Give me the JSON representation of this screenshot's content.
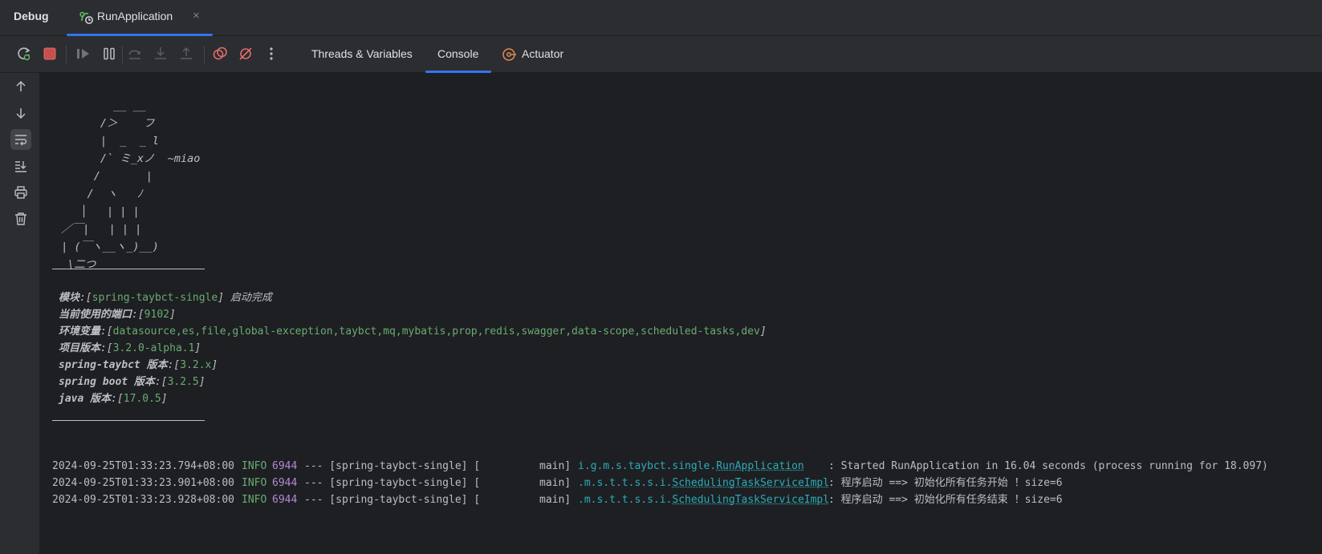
{
  "window": {
    "debug_title": "Debug",
    "run_tab": {
      "label": "RunApplication",
      "close": "×",
      "icon": "run-config-icon"
    }
  },
  "toolbar": {
    "buttons": [
      {
        "name": "rerun-button",
        "icon": "rerun-icon"
      },
      {
        "name": "stop-button",
        "icon": "stop-icon"
      },
      {
        "name": "resume-button",
        "icon": "resume-icon"
      },
      {
        "name": "pause-button",
        "icon": "pause-icon"
      },
      {
        "name": "step-over-button",
        "icon": "step-over-icon"
      },
      {
        "name": "step-into-button",
        "icon": "step-into-icon"
      },
      {
        "name": "step-out-button",
        "icon": "step-out-icon"
      },
      {
        "name": "view-breakpoints-button",
        "icon": "view-breakpoints-icon"
      },
      {
        "name": "mute-breakpoints-button",
        "icon": "mute-breakpoints-icon"
      },
      {
        "name": "more-button",
        "icon": "more-vertical-icon"
      }
    ],
    "tabs": [
      {
        "label": "Threads & Variables",
        "active": false
      },
      {
        "label": "Console",
        "active": true
      },
      {
        "label": "Actuator",
        "active": false,
        "icon": "actuator-icon"
      }
    ]
  },
  "side_toolbar": [
    {
      "name": "up-arrow-icon"
    },
    {
      "name": "down-arrow-icon"
    },
    {
      "name": "soft-wrap-icon",
      "active": true
    },
    {
      "name": "scroll-to-end-icon"
    },
    {
      "name": "print-icon"
    },
    {
      "name": "clear-all-icon"
    }
  ],
  "console": {
    "banner": [
      "         __ __",
      "       /＞    フ",
      "       |  _  _ l",
      "       /` ミ_xノ  ~miao",
      "      /       |",
      "     /  ヽ   ﾉ",
      "    │   | | |",
      " ／￣|   | | |",
      " | (￣ヽ__ヽ_)__)",
      "  \\二つ"
    ],
    "info": [
      {
        "key": "模块",
        "sep": ":[",
        "value": "spring-taybct-single",
        "after": "] 启动完成"
      },
      {
        "key": "当前使用的端口",
        "sep": ":[",
        "value": "9102",
        "after": "]"
      },
      {
        "key": "环境变量",
        "sep": ":[",
        "value": "datasource,es,file,global-exception,taybct,mq,mybatis,prop,redis,swagger,data-scope,scheduled-tasks,dev",
        "after": "]"
      },
      {
        "key": "项目版本",
        "sep": ":[",
        "value": "3.2.0-alpha.1",
        "after": "]"
      },
      {
        "key": "spring-taybct 版本",
        "sep": ":[",
        "value": "3.2.x",
        "after": "]"
      },
      {
        "key": "spring boot 版本",
        "sep": ":[",
        "value": "3.2.5",
        "after": "]"
      },
      {
        "key": "java 版本",
        "sep": ":[",
        "value": "17.0.5",
        "after": "]"
      }
    ],
    "logs": [
      {
        "timestamp": "2024-09-25T01:33:23.794+08:00",
        "level": "INFO",
        "pid": "6944",
        "app": "--- [spring-taybct-single] [",
        "thread": "main]",
        "logger_prefix": "i.g.m.s.taybct.single.",
        "logger_class": "RunApplication",
        "message": ": Started RunApplication in 16.04 seconds (process running for 18.097)"
      },
      {
        "timestamp": "2024-09-25T01:33:23.901+08:00",
        "level": "INFO",
        "pid": "6944",
        "app": "--- [spring-taybct-single] [",
        "thread": "main]",
        "logger_prefix": ".m.s.t.t.s.s.i.",
        "logger_class": "SchedulingTaskServiceImpl",
        "message": ": 程序启动 ==> 初始化所有任务开始 ！size=6"
      },
      {
        "timestamp": "2024-09-25T01:33:23.928+08:00",
        "level": "INFO",
        "pid": "6944",
        "app": "--- [spring-taybct-single] [",
        "thread": "main]",
        "logger_prefix": ".m.s.t.t.s.s.i.",
        "logger_class": "SchedulingTaskServiceImpl",
        "message": ": 程序启动 ==> 初始化所有任务结束 ！size=6"
      }
    ]
  }
}
